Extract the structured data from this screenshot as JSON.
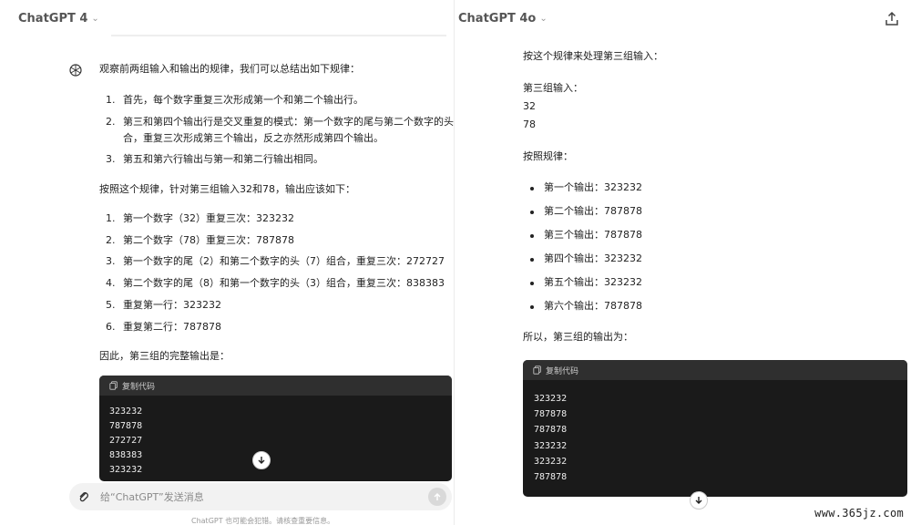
{
  "left": {
    "model_name": "ChatGPT 4",
    "intro": "观察前两组输入和输出的规律，我们可以总结出如下规律：",
    "rules": [
      {
        "num": "1.",
        "text": "首先，每个数字重复三次形成第一个和第二个输出行。"
      },
      {
        "num": "2.",
        "text": "第三和第四个输出行是交叉重复的模式：第一个数字的尾与第二个数字的头组"
      },
      {
        "num": "3.",
        "text": "第五和第六行输出与第一和第二行输出相同。"
      }
    ],
    "rule2_cont": "合，重复三次形成第三个输出，反之亦然形成第四个输出。",
    "apply_text": "按照这个规律，针对第三组输入32和78，输出应该如下：",
    "steps": [
      {
        "num": "1.",
        "text": "第一个数字（32）重复三次：323232"
      },
      {
        "num": "2.",
        "text": "第二个数字（78）重复三次：787878"
      },
      {
        "num": "3.",
        "text": "第一个数字的尾（2）和第二个数字的头（7）组合，重复三次：272727"
      },
      {
        "num": "4.",
        "text": "第二个数字的尾（8）和第一个数字的头（3）组合，重复三次：838383"
      },
      {
        "num": "5.",
        "text": "重复第一行：323232"
      },
      {
        "num": "6.",
        "text": "重复第二行：787878"
      }
    ],
    "conclusion": "因此，第三组的完整输出是：",
    "code_copy_label": "复制代码",
    "code_lines": [
      "323232",
      "787878",
      "272727",
      "838383",
      "323232"
    ],
    "composer_placeholder": "给“ChatGPT”发送消息",
    "footnote": "ChatGPT 也可能会犯错。请核查重要信息。"
  },
  "right": {
    "model_name": "ChatGPT 4o",
    "p1": "按这个规律来处理第三组输入：",
    "input_label": "第三组输入：",
    "input_values": [
      "32",
      "78"
    ],
    "rule_label": "按照规律：",
    "outputs": [
      "第一个输出：323232",
      "第二个输出：787878",
      "第三个输出：787878",
      "第四个输出：323232",
      "第五个输出：323232",
      "第六个输出：787878"
    ],
    "result_label": "所以，第三组的输出为：",
    "code_copy_label": "复制代码",
    "code_lines": [
      "323232",
      "787878",
      "787878",
      "323232",
      "323232",
      "787878"
    ]
  },
  "watermark": "www.365jz.com",
  "icons": {
    "chevron": "chevron-down-icon",
    "share": "share-icon",
    "avatar": "openai-logo-icon",
    "copy": "copy-icon",
    "scroll": "arrow-down-icon",
    "attach": "paperclip-icon",
    "send": "arrow-up-icon"
  }
}
